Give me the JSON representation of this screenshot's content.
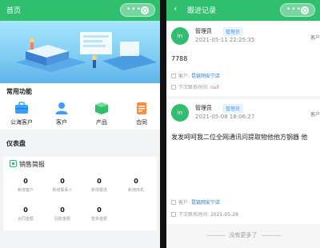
{
  "left": {
    "header": {
      "title": "首页"
    },
    "banner": {
      "dots": 3,
      "active_dot": 1
    },
    "common_functions": {
      "title": "常用功能",
      "items": [
        {
          "label": "公海客户",
          "icon": "briefcase-icon",
          "color": "#3aa0ff"
        },
        {
          "label": "客户",
          "icon": "user-icon",
          "color": "#3aa0ff"
        },
        {
          "label": "产品",
          "icon": "box-icon",
          "color": "#2fbf6e"
        },
        {
          "label": "合同",
          "icon": "contract-icon",
          "color": "#ff8a3d"
        }
      ]
    },
    "dashboard": {
      "title": "仪表盘",
      "card_title": "销售简报",
      "stats": [
        {
          "value": "0",
          "label": "新增客户"
        },
        {
          "value": "0",
          "label": "新增联系人"
        },
        {
          "value": "0",
          "label": "新增跟进"
        },
        {
          "value": "0",
          "label": "新增商机"
        },
        {
          "value": "0",
          "label": "合同金额"
        },
        {
          "value": "0",
          "label": "回款金额"
        },
        {
          "value": "0",
          "label": "签单金额"
        }
      ]
    }
  },
  "right": {
    "header": {
      "title": "跟进记录"
    },
    "records": [
      {
        "avatar": "in",
        "name": "管理员",
        "role": "管理员",
        "date": "2021-05-11 22:25:35",
        "customer_side": "客户",
        "content": "7788",
        "customer_label": "客户",
        "customer_name": "昆链网安宁店",
        "next_label": "下次联系时间",
        "next_value": "null"
      },
      {
        "avatar": "in",
        "name": "管理员",
        "role": "管理员",
        "date": "2021-05-08 18:06:27",
        "customer_side": "客户",
        "content": "发发呵呵我二位全网通讯问提取物他他方钢器 他",
        "customer_label": "客户",
        "customer_name": "昆链网安宁店",
        "next_label": "下次联系时间",
        "next_value": "2021-05-28"
      }
    ],
    "footer": "没有更多了"
  },
  "colors": {
    "primary": "#2fbf6e",
    "link": "#2a78d6"
  }
}
